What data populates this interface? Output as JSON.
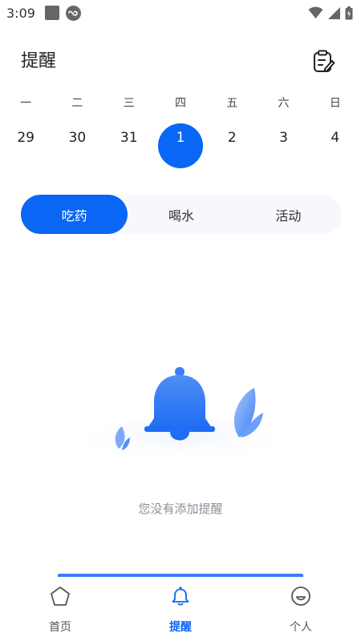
{
  "status": {
    "time": "3:09"
  },
  "header": {
    "title": "提醒"
  },
  "calendar": {
    "weekdays": [
      "一",
      "二",
      "三",
      "四",
      "五",
      "六",
      "日"
    ],
    "dates": [
      "29",
      "30",
      "31",
      "1",
      "2",
      "3",
      "4"
    ],
    "selected_date": "1"
  },
  "tabs": {
    "items": [
      "吃药",
      "喝水",
      "活动"
    ],
    "active": "吃药"
  },
  "empty_state": {
    "message": "您没有添加提醒"
  },
  "bottom_nav": {
    "items": [
      "首页",
      "提醒",
      "个人"
    ],
    "active": "提醒"
  },
  "colors": {
    "accent": "#0a66f5",
    "muted_text": "#8a8f99",
    "segment_bg": "#f6f8fc"
  },
  "icons": {
    "status": [
      "stop-icon",
      "link-icon",
      "wifi-icon",
      "signal-icon",
      "battery-icon"
    ],
    "header": "clipboard-edit-icon",
    "nav": [
      "home-pentagon-icon",
      "bell-icon",
      "smile-face-icon"
    ]
  }
}
